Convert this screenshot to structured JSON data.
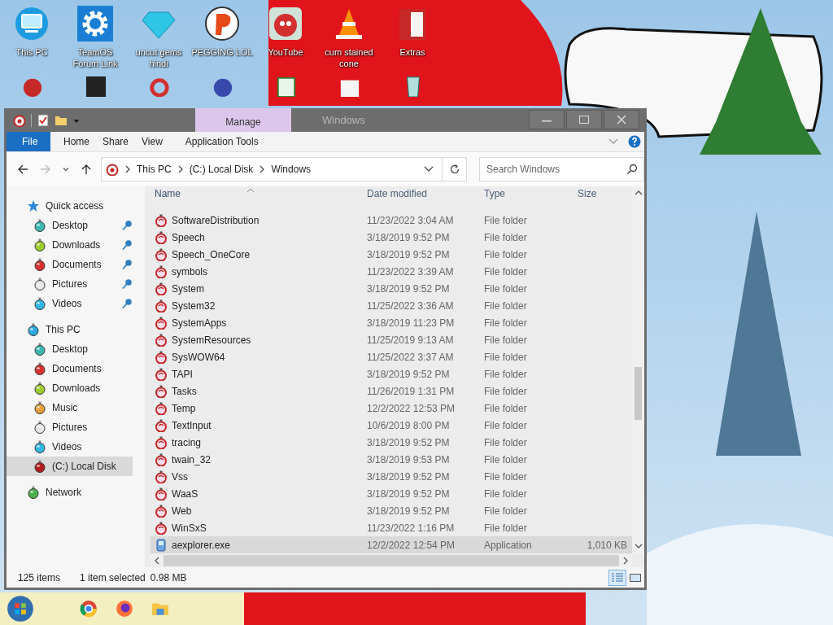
{
  "desktop_icons": [
    {
      "label": "This PC",
      "kind": "pc"
    },
    {
      "label": "TeamOS Forum Link",
      "kind": "gear"
    },
    {
      "label": "uncut gems hindi",
      "kind": "gem"
    },
    {
      "label": "PEGGING LOL",
      "kind": "letter"
    },
    {
      "label": "YouTube",
      "kind": "bird"
    },
    {
      "label": "cum stained cone",
      "kind": "cone"
    },
    {
      "label": "Extras",
      "kind": "book"
    }
  ],
  "window": {
    "title": "Windows",
    "context_tab": "Manage",
    "ribbon_tabs": [
      {
        "label": "File",
        "kind": "file"
      },
      {
        "label": "Home",
        "kind": "plain"
      },
      {
        "label": "Share",
        "kind": "plain"
      },
      {
        "label": "View",
        "kind": "plain"
      },
      {
        "label": "Application Tools",
        "kind": "context"
      }
    ],
    "breadcrumbs": [
      "This PC",
      "(C:) Local Disk",
      "Windows"
    ],
    "search": {
      "placeholder": "Search Windows"
    },
    "sidebar": [
      {
        "label": "Quick access",
        "kind": "star",
        "selected": false,
        "children": [
          {
            "label": "Desktop",
            "kind": "teal",
            "pinned": true,
            "selected": false
          },
          {
            "label": "Downloads",
            "kind": "lime",
            "pinned": true,
            "selected": false
          },
          {
            "label": "Documents",
            "kind": "red",
            "pinned": true,
            "selected": false
          },
          {
            "label": "Pictures",
            "kind": "white",
            "pinned": true,
            "selected": false
          },
          {
            "label": "Videos",
            "kind": "cyan",
            "pinned": true,
            "selected": false
          }
        ]
      },
      {
        "label": "This PC",
        "kind": "pc",
        "selected": false,
        "children": [
          {
            "label": "Desktop",
            "kind": "teal",
            "pinned": false,
            "selected": false
          },
          {
            "label": "Documents",
            "kind": "red",
            "pinned": false,
            "selected": false
          },
          {
            "label": "Downloads",
            "kind": "lime",
            "pinned": false,
            "selected": false
          },
          {
            "label": "Music",
            "kind": "orange",
            "pinned": false,
            "selected": false
          },
          {
            "label": "Pictures",
            "kind": "white",
            "pinned": false,
            "selected": false
          },
          {
            "label": "Videos",
            "kind": "cyan",
            "pinned": false,
            "selected": false
          },
          {
            "label": "(C:) Local Disk",
            "kind": "drive",
            "pinned": false,
            "selected": true
          }
        ]
      },
      {
        "label": "Network",
        "kind": "network",
        "selected": false
      }
    ],
    "columns": [
      {
        "label": "Name",
        "sorted": true
      },
      {
        "label": "Date modified",
        "sorted": false
      },
      {
        "label": "Type",
        "sorted": false
      },
      {
        "label": "Size",
        "sorted": false
      }
    ],
    "rows": [
      {
        "name": "SoftwareDistribution",
        "date": "11/23/2022 3:04 AM",
        "type": "File folder",
        "kind": "folder",
        "selected": false
      },
      {
        "name": "Speech",
        "date": "3/18/2019 9:52 PM",
        "type": "File folder",
        "kind": "folder",
        "selected": false
      },
      {
        "name": "Speech_OneCore",
        "date": "3/18/2019 9:52 PM",
        "type": "File folder",
        "kind": "folder",
        "selected": false
      },
      {
        "name": "symbols",
        "date": "11/23/2022 3:39 AM",
        "type": "File folder",
        "kind": "folder",
        "selected": false
      },
      {
        "name": "System",
        "date": "3/18/2019 9:52 PM",
        "type": "File folder",
        "kind": "folder",
        "selected": false
      },
      {
        "name": "System32",
        "date": "11/25/2022 3:36 AM",
        "type": "File folder",
        "kind": "folder",
        "selected": false
      },
      {
        "name": "SystemApps",
        "date": "3/18/2019 11:23 PM",
        "type": "File folder",
        "kind": "folder",
        "selected": false
      },
      {
        "name": "SystemResources",
        "date": "11/25/2019 9:13 AM",
        "type": "File folder",
        "kind": "folder",
        "selected": false
      },
      {
        "name": "SysWOW64",
        "date": "11/25/2022 3:37 AM",
        "type": "File folder",
        "kind": "folder",
        "selected": false
      },
      {
        "name": "TAPI",
        "date": "3/18/2019 9:52 PM",
        "type": "File folder",
        "kind": "folder",
        "selected": false
      },
      {
        "name": "Tasks",
        "date": "11/26/2019 1:31 PM",
        "type": "File folder",
        "kind": "folder",
        "selected": false
      },
      {
        "name": "Temp",
        "date": "12/2/2022 12:53 PM",
        "type": "File folder",
        "kind": "folder",
        "selected": false
      },
      {
        "name": "TextInput",
        "date": "10/6/2019 8:00 PM",
        "type": "File folder",
        "kind": "folder",
        "selected": false
      },
      {
        "name": "tracing",
        "date": "3/18/2019 9:52 PM",
        "type": "File folder",
        "kind": "folder",
        "selected": false
      },
      {
        "name": "twain_32",
        "date": "3/18/2019 9:53 PM",
        "type": "File folder",
        "kind": "folder",
        "selected": false
      },
      {
        "name": "Vss",
        "date": "3/18/2019 9:52 PM",
        "type": "File folder",
        "kind": "folder",
        "selected": false
      },
      {
        "name": "WaaS",
        "date": "3/18/2019 9:52 PM",
        "type": "File folder",
        "kind": "folder",
        "selected": false
      },
      {
        "name": "Web",
        "date": "3/18/2019 9:52 PM",
        "type": "File folder",
        "kind": "folder",
        "selected": false
      },
      {
        "name": "WinSxS",
        "date": "11/23/2022 1:16 PM",
        "type": "File folder",
        "kind": "folder",
        "selected": false
      },
      {
        "name": "aexplorer.exe",
        "date": "12/2/2022 12:54 PM",
        "type": "Application",
        "size": "1,010 KB",
        "kind": "app",
        "selected": true
      }
    ],
    "status_bar": {
      "count": "125 items",
      "selection": "1 item selected",
      "size": "0.98 MB"
    }
  }
}
